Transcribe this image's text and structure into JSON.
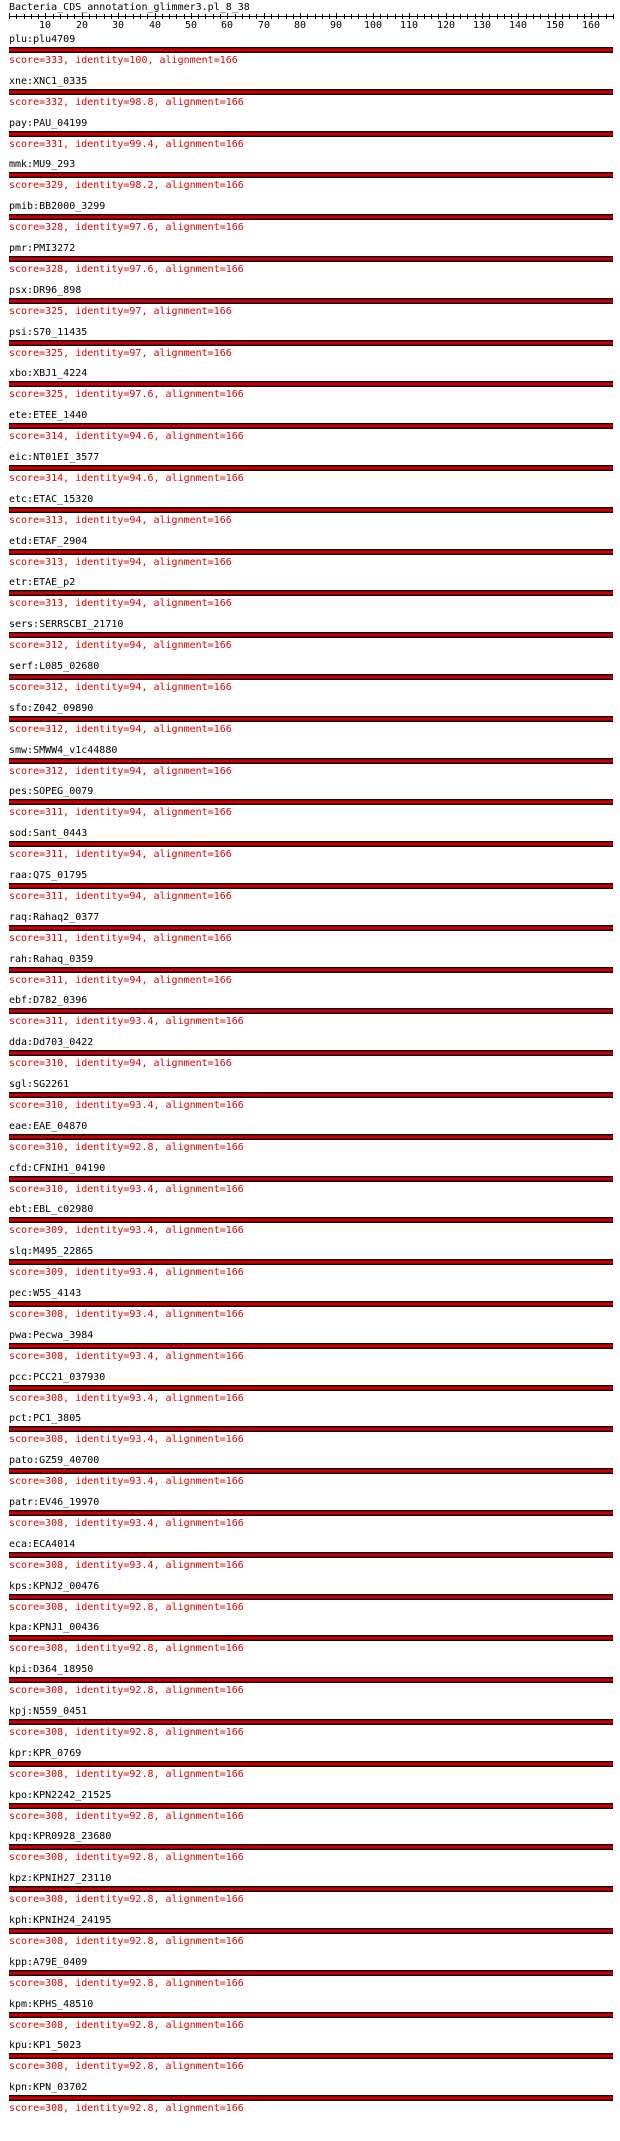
{
  "title": "Bacteria_CDS_annotation_glimmer3.pl_8_38",
  "ruler": {
    "labels": [
      "10",
      "20",
      "30",
      "40",
      "50",
      "60",
      "70",
      "80",
      "90",
      "100",
      "110",
      "120",
      "130",
      "140",
      "150",
      "160"
    ]
  },
  "colors": {
    "bar": "#cc0000",
    "score_text": "#e00000"
  },
  "hits": [
    {
      "name": "plu:plu4709",
      "score": "score=333, identity=100, alignment=166"
    },
    {
      "name": "xne:XNC1_0335",
      "score": "score=332, identity=98.8, alignment=166"
    },
    {
      "name": "pay:PAU_04199",
      "score": "score=331, identity=99.4, alignment=166"
    },
    {
      "name": "mmk:MU9_293",
      "score": "score=329, identity=98.2, alignment=166"
    },
    {
      "name": "pmib:BB2000_3299",
      "score": "score=328, identity=97.6, alignment=166"
    },
    {
      "name": "pmr:PMI3272",
      "score": "score=328, identity=97.6, alignment=166"
    },
    {
      "name": "psx:DR96_898",
      "score": "score=325, identity=97, alignment=166"
    },
    {
      "name": "psi:S70_11435",
      "score": "score=325, identity=97, alignment=166"
    },
    {
      "name": "xbo:XBJ1_4224",
      "score": "score=325, identity=97.6, alignment=166"
    },
    {
      "name": "ete:ETEE_1440",
      "score": "score=314, identity=94.6, alignment=166"
    },
    {
      "name": "eic:NT01EI_3577",
      "score": "score=314, identity=94.6, alignment=166"
    },
    {
      "name": "etc:ETAC_15320",
      "score": "score=313, identity=94, alignment=166"
    },
    {
      "name": "etd:ETAF_2904",
      "score": "score=313, identity=94, alignment=166"
    },
    {
      "name": "etr:ETAE_p2",
      "score": "score=313, identity=94, alignment=166"
    },
    {
      "name": "sers:SERRSCBI_21710",
      "score": "score=312, identity=94, alignment=166"
    },
    {
      "name": "serf:L085_02680",
      "score": "score=312, identity=94, alignment=166"
    },
    {
      "name": "sfo:Z042_09890",
      "score": "score=312, identity=94, alignment=166"
    },
    {
      "name": "smw:SMWW4_v1c44880",
      "score": "score=312, identity=94, alignment=166"
    },
    {
      "name": "pes:SOPEG_0079",
      "score": "score=311, identity=94, alignment=166"
    },
    {
      "name": "sod:Sant_0443",
      "score": "score=311, identity=94, alignment=166"
    },
    {
      "name": "raa:Q7S_01795",
      "score": "score=311, identity=94, alignment=166"
    },
    {
      "name": "raq:Rahaq2_0377",
      "score": "score=311, identity=94, alignment=166"
    },
    {
      "name": "rah:Rahaq_0359",
      "score": "score=311, identity=94, alignment=166"
    },
    {
      "name": "ebf:D782_0396",
      "score": "score=311, identity=93.4, alignment=166"
    },
    {
      "name": "dda:Dd703_0422",
      "score": "score=310, identity=94, alignment=166"
    },
    {
      "name": "sgl:SG2261",
      "score": "score=310, identity=93.4, alignment=166"
    },
    {
      "name": "eae:EAE_04870",
      "score": "score=310, identity=92.8, alignment=166"
    },
    {
      "name": "cfd:CFNIH1_04190",
      "score": "score=310, identity=93.4, alignment=166"
    },
    {
      "name": "ebt:EBL_c02980",
      "score": "score=309, identity=93.4, alignment=166"
    },
    {
      "name": "slq:M495_22865",
      "score": "score=309, identity=93.4, alignment=166"
    },
    {
      "name": "pec:W5S_4143",
      "score": "score=308, identity=93.4, alignment=166"
    },
    {
      "name": "pwa:Pecwa_3984",
      "score": "score=308, identity=93.4, alignment=166"
    },
    {
      "name": "pcc:PCC21_037930",
      "score": "score=308, identity=93.4, alignment=166"
    },
    {
      "name": "pct:PC1_3805",
      "score": "score=308, identity=93.4, alignment=166"
    },
    {
      "name": "pato:GZ59_40700",
      "score": "score=308, identity=93.4, alignment=166"
    },
    {
      "name": "patr:EV46_19970",
      "score": "score=308, identity=93.4, alignment=166"
    },
    {
      "name": "eca:ECA4014",
      "score": "score=308, identity=93.4, alignment=166"
    },
    {
      "name": "kps:KPNJ2_00476",
      "score": "score=308, identity=92.8, alignment=166"
    },
    {
      "name": "kpa:KPNJ1_00436",
      "score": "score=308, identity=92.8, alignment=166"
    },
    {
      "name": "kpi:D364_18950",
      "score": "score=308, identity=92.8, alignment=166"
    },
    {
      "name": "kpj:N559_0451",
      "score": "score=308, identity=92.8, alignment=166"
    },
    {
      "name": "kpr:KPR_0769",
      "score": "score=308, identity=92.8, alignment=166"
    },
    {
      "name": "kpo:KPN2242_21525",
      "score": "score=308, identity=92.8, alignment=166"
    },
    {
      "name": "kpq:KPR0928_23680",
      "score": "score=308, identity=92.8, alignment=166"
    },
    {
      "name": "kpz:KPNIH27_23110",
      "score": "score=308, identity=92.8, alignment=166"
    },
    {
      "name": "kph:KPNIH24_24195",
      "score": "score=308, identity=92.8, alignment=166"
    },
    {
      "name": "kpp:A79E_0409",
      "score": "score=308, identity=92.8, alignment=166"
    },
    {
      "name": "kpm:KPHS_48510",
      "score": "score=308, identity=92.8, alignment=166"
    },
    {
      "name": "kpu:KP1_5023",
      "score": "score=308, identity=92.8, alignment=166"
    },
    {
      "name": "kpn:KPN_03702",
      "score": "score=308, identity=92.8, alignment=166"
    }
  ]
}
